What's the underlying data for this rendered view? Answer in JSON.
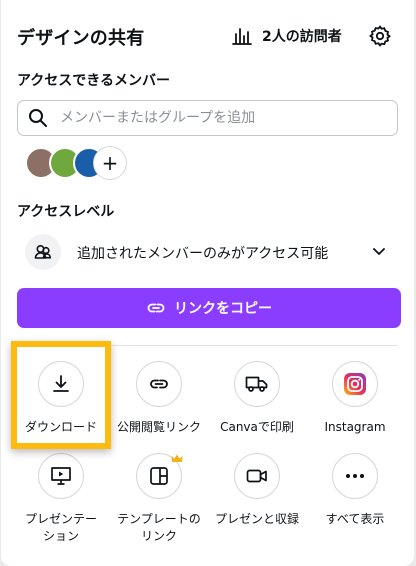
{
  "header": {
    "title": "デザインの共有",
    "visitors_label": "2人の訪問者"
  },
  "members": {
    "label": "アクセスできるメンバー",
    "search_placeholder": "メンバーまたはグループを追加",
    "avatar_colors": [
      "#8c7066",
      "#6fa83c",
      "#1a5eaa"
    ],
    "add_glyph": "+"
  },
  "access": {
    "label": "アクセスレベル",
    "value": "追加されたメンバーのみがアクセス可能"
  },
  "copy_button": {
    "label": "リンクをコピー",
    "color": "#8b3dff"
  },
  "share_options": [
    {
      "label": "ダウンロード",
      "icon": "download-icon"
    },
    {
      "label": "公開閲覧リンク",
      "icon": "link-icon"
    },
    {
      "label": "Canvaで印刷",
      "icon": "truck-icon"
    },
    {
      "label": "Instagram",
      "icon": "instagram-icon"
    },
    {
      "label": "プレゼンテー\nション",
      "icon": "presentation-icon"
    },
    {
      "label": "テンプレートの\nリンク",
      "icon": "template-icon",
      "premium": true
    },
    {
      "label": "プレゼンと収録",
      "icon": "record-icon"
    },
    {
      "label": "すべて表示",
      "icon": "more-icon"
    }
  ],
  "highlight_color": "#fdbb10"
}
